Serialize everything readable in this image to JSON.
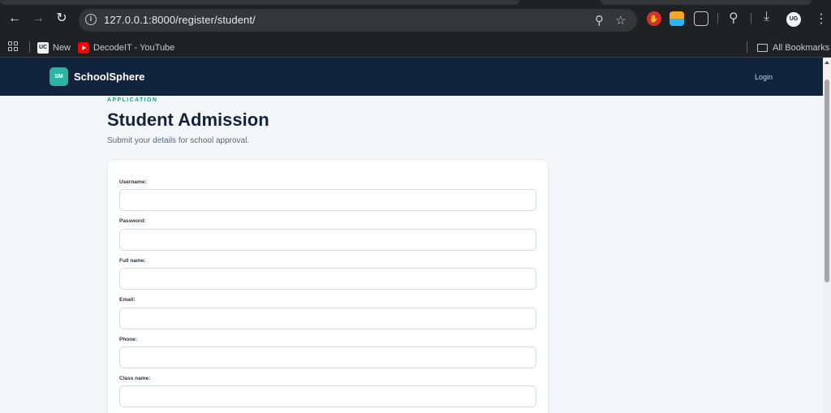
{
  "browser": {
    "url": "127.0.0.1:8000/register/student/",
    "profile_initials": "UG",
    "icons": [
      "back-icon",
      "forward-icon",
      "reload-icon",
      "info-icon",
      "zoom-icon",
      "star-icon",
      "puzzle-icon",
      "download-icon",
      "kebab-icon"
    ],
    "bookmarks": [
      {
        "label": "New",
        "icon": "uc-icon"
      },
      {
        "label": "DecodeIT - YouTube",
        "icon": "youtube-icon"
      }
    ],
    "all_bookmarks": "All Bookmarks"
  },
  "header": {
    "logo_text": "SM",
    "brand": "SchoolSphere",
    "login": "Login"
  },
  "page": {
    "eyebrow": "APPLICATION",
    "title": "Student Admission",
    "subtitle": "Submit your details for school approval."
  },
  "form": {
    "fields": [
      {
        "label": "Username:",
        "value": ""
      },
      {
        "label": "Password:",
        "value": ""
      },
      {
        "label": "Full name:",
        "value": ""
      },
      {
        "label": "Email:",
        "value": ""
      },
      {
        "label": "Phone:",
        "value": ""
      },
      {
        "label": "Class name:",
        "value": ""
      }
    ]
  },
  "colors": {
    "header_bg": "#10243e",
    "accent": "#2bb3a3",
    "page_bg": "#f4f7fa"
  }
}
